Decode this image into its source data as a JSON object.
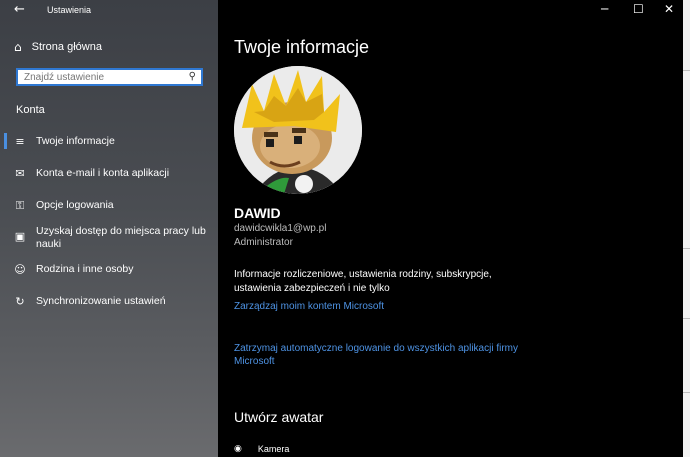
{
  "window": {
    "title": "Ustawienia"
  },
  "sidebar": {
    "home_label": "Strona główna",
    "search_placeholder": "Znajdź ustawienie",
    "section_title": "Konta",
    "items": [
      {
        "label": "Twoje informacje",
        "icon": "user-card-icon",
        "active": true
      },
      {
        "label": "Konta e-mail i konta aplikacji",
        "icon": "mail-icon"
      },
      {
        "label": "Opcje logowania",
        "icon": "key-icon"
      },
      {
        "label": "Uzyskaj dostęp do miejsca pracy lub nauki",
        "icon": "briefcase-icon"
      },
      {
        "label": "Rodzina i inne osoby",
        "icon": "person-icon"
      },
      {
        "label": "Synchronizowanie ustawień",
        "icon": "sync-icon"
      }
    ]
  },
  "main": {
    "title": "Twoje informacje",
    "user_name": "DAWID",
    "email": "dawidcwikla1@wp.pl",
    "role": "Administrator",
    "info_text": "Informacje rozliczeniowe, ustawienia rodziny, subskrypcje, ustawienia zabezpieczeń i nie tylko",
    "manage_link": "Zarządzaj moim kontem Microsoft",
    "stop_link": "Zatrzymaj automatyczne logowanie do wszystkich aplikacji firmy Microsoft",
    "avatar_section": "Utwórz awatar",
    "camera_label": "Kamera"
  },
  "colors": {
    "accent": "#4e93e4",
    "background": "#000000",
    "sidebar": "#4a4d52"
  }
}
